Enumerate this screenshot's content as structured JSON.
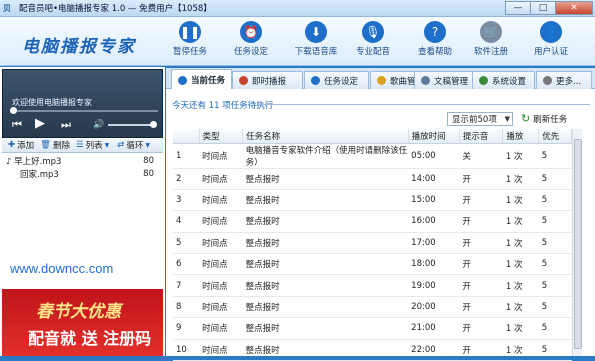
{
  "window": {
    "app_icon": "贝",
    "title": "配音员吧•电脑播报专家 1.0 — 免费用户【1058】",
    "min": "—",
    "max": "□",
    "close": "✕"
  },
  "brand": "电脑播报专家",
  "toolbar": [
    {
      "label": "暂停任务",
      "icon": "pause-icon",
      "glyph": "❚❚",
      "color": "#1d6fc9"
    },
    {
      "label": "任务设定",
      "icon": "alarm-clock-icon",
      "glyph": "⏰",
      "color": "#1d6fc9"
    },
    {
      "label": "下载语音库",
      "icon": "download-icon",
      "glyph": "⬇",
      "color": "#1d6fc9"
    },
    {
      "label": "专业配音",
      "icon": "microphone-icon",
      "glyph": "🎙",
      "color": "#1d6fc9"
    },
    {
      "label": "查看帮助",
      "icon": "help-icon",
      "glyph": "?",
      "color": "#1d6fc9"
    },
    {
      "label": "软件注册",
      "icon": "cart-icon",
      "glyph": "🛒",
      "color": "#7a8da3"
    },
    {
      "label": "用户认证",
      "icon": "user-auth-icon",
      "glyph": "👤",
      "color": "#1d6fc9"
    }
  ],
  "player": {
    "now_playing": "欢迎使用电脑播报专家",
    "prev": "⏮",
    "play": "▶",
    "next": "⏭",
    "volume_icon": "🔊",
    "progress": 0.0,
    "volume": 1.0
  },
  "playlist_bar": {
    "add": "添加",
    "delete": "删除",
    "list": "列表",
    "loop": "循环"
  },
  "playlist": [
    {
      "name": "早上好.mp3",
      "duration": "80",
      "active": true
    },
    {
      "name": "回家.mp3",
      "duration": "80",
      "active": false
    }
  ],
  "website": "www.downcc.com",
  "promo": {
    "line1": "春节大优惠",
    "line2": "配音就 送 注册码"
  },
  "tabs": [
    {
      "label": "当前任务",
      "icon": "home-icon",
      "color": "#1d6fc9",
      "active": true
    },
    {
      "label": "即时播报",
      "icon": "broadcast-icon",
      "color": "#c7452d",
      "active": false
    },
    {
      "label": "任务设定",
      "icon": "clock-icon",
      "color": "#1d6fc9",
      "active": false
    },
    {
      "label": "歌曲管理",
      "icon": "music-icon",
      "color": "#d9a11d",
      "active": false
    },
    {
      "label": "文稿管理",
      "icon": "document-icon",
      "color": "#5c7a9a",
      "active": false
    },
    {
      "label": "系统设置",
      "icon": "settings-icon",
      "color": "#3a8a3a",
      "active": false
    },
    {
      "label": "更多...",
      "icon": "more-icon",
      "color": "#777",
      "active": false
    }
  ],
  "main": {
    "banner": "今天还有 11 项任务待执行",
    "page_size": "显示前50项",
    "refresh": "刷新任务",
    "columns": [
      "",
      "类型",
      "任务名称",
      "播放时间",
      "提示音",
      "播放",
      "优先"
    ],
    "rows": [
      [
        "1",
        "时间点",
        "电脑播音专家软件介绍（使用时请删除该任务）",
        "05:00",
        "关",
        "1 次",
        "5"
      ],
      [
        "2",
        "时间点",
        "整点报时",
        "14:00",
        "开",
        "1 次",
        "5"
      ],
      [
        "3",
        "时间点",
        "整点报时",
        "15:00",
        "开",
        "1 次",
        "5"
      ],
      [
        "4",
        "时间点",
        "整点报时",
        "16:00",
        "开",
        "1 次",
        "5"
      ],
      [
        "5",
        "时间点",
        "整点报时",
        "17:00",
        "开",
        "1 次",
        "5"
      ],
      [
        "6",
        "时间点",
        "整点报时",
        "18:00",
        "开",
        "1 次",
        "5"
      ],
      [
        "7",
        "时间点",
        "整点报时",
        "19:00",
        "开",
        "1 次",
        "5"
      ],
      [
        "8",
        "时间点",
        "整点报时",
        "20:00",
        "开",
        "1 次",
        "5"
      ],
      [
        "9",
        "时间点",
        "整点报时",
        "21:00",
        "开",
        "1 次",
        "5"
      ],
      [
        "10",
        "时间点",
        "整点报时",
        "22:00",
        "开",
        "1 次",
        "5"
      ]
    ]
  }
}
